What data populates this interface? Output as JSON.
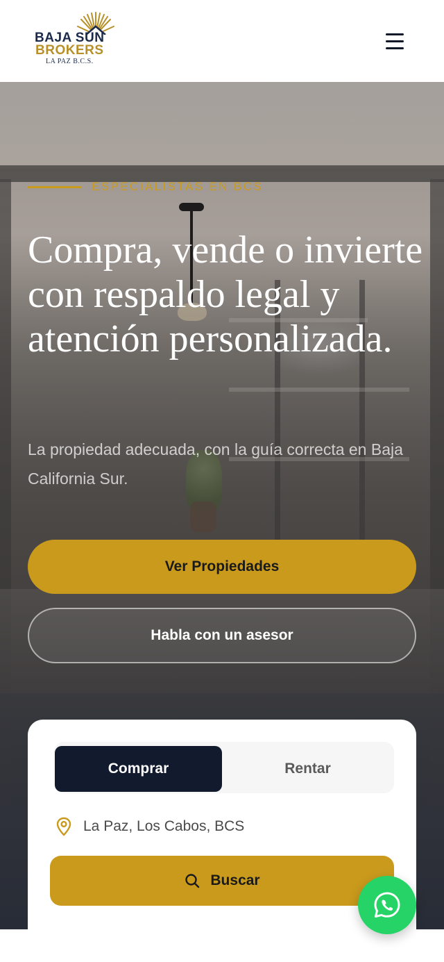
{
  "header": {
    "logo": {
      "line1": "BAJA SUN",
      "line2": "BROKERS",
      "line3": "LA PAZ B.C.S.",
      "icon": "sun-icon"
    },
    "menu_icon": "hamburger-menu-icon"
  },
  "hero": {
    "eyebrow": "ESPECIALISTAS EN BCS",
    "headline": "Compra, vende o invierte con respaldo legal y atención personalizada.",
    "subtitle": "La propiedad adecuada, con la guía correcta en Baja California Sur.",
    "primary_cta": "Ver Propiedades",
    "secondary_cta": "Habla con un asesor"
  },
  "search": {
    "tabs": [
      {
        "label": "Comprar",
        "active": true
      },
      {
        "label": "Rentar",
        "active": false
      }
    ],
    "location_text": "La Paz, Los Cabos, BCS",
    "location_icon": "map-pin-icon",
    "button_label": "Buscar",
    "button_icon": "search-icon"
  },
  "floating": {
    "whatsapp_icon": "whatsapp-icon"
  },
  "colors": {
    "accent": "#c99a1c",
    "navy": "#121a2e",
    "whatsapp": "#25d366",
    "brand_blue": "#1a2a4a",
    "brand_gold": "#b8902a"
  }
}
